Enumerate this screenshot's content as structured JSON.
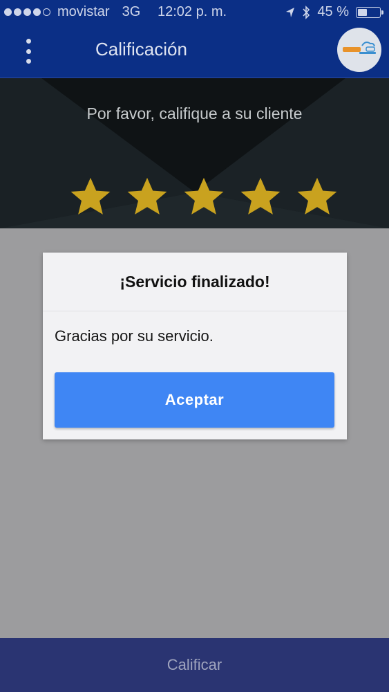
{
  "status_bar": {
    "carrier": "movistar",
    "network": "3G",
    "time": "12:02 p. m.",
    "battery": "45 %",
    "battery_level": 0.45
  },
  "header": {
    "title": "Calificación",
    "menu_icon": "more-vertical-icon",
    "logo_icon": "app-logo"
  },
  "rating": {
    "prompt": "Por favor, califique a su cliente",
    "stars_total": 5,
    "stars_filled": 5,
    "star_color": "#c9a21f"
  },
  "dialog": {
    "title": "¡Servicio finalizado!",
    "message": "Gracias por su servicio.",
    "accept_label": "Aceptar",
    "accept_color": "#3f86f4"
  },
  "bottom_bar": {
    "label": "Calificar"
  }
}
